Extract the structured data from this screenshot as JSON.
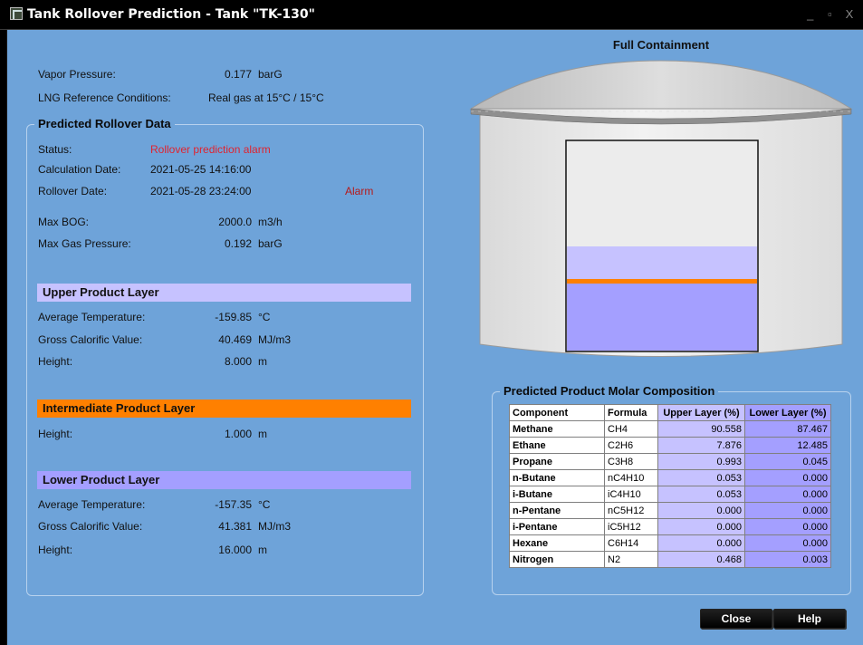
{
  "window": {
    "title": "Tank Rollover Prediction - Tank \"TK-130\"",
    "minimize": "_",
    "maximize": "▫",
    "close": "X"
  },
  "summary": {
    "vapor_pressure_label": "Vapor Pressure:",
    "vapor_pressure_value": "0.177",
    "vapor_pressure_unit": "barG",
    "lng_ref_label": "LNG Reference Conditions:",
    "lng_ref_value": "Real gas at 15°C / 15°C"
  },
  "rollover": {
    "group_title": "Predicted Rollover Data",
    "status_label": "Status:",
    "status_value": "Rollover prediction alarm",
    "calc_date_label": "Calculation Date:",
    "calc_date_value": "2021-05-25 14:16:00",
    "rollover_date_label": "Rollover Date:",
    "rollover_date_value": "2021-05-28 23:24:00",
    "alarm_text": "Alarm",
    "max_bog_label": "Max BOG:",
    "max_bog_value": "2000.0",
    "max_bog_unit": "m3/h",
    "max_gas_pressure_label": "Max Gas Pressure:",
    "max_gas_pressure_value": "0.192",
    "max_gas_pressure_unit": "barG"
  },
  "upper": {
    "title": "Upper Product Layer",
    "avg_temp_label": "Average Temperature:",
    "avg_temp_value": "-159.85",
    "avg_temp_unit": "°C",
    "gcv_label": "Gross Calorific Value:",
    "gcv_value": "40.469",
    "gcv_unit": "MJ/m3",
    "height_label": "Height:",
    "height_value": "8.000",
    "height_unit": "m"
  },
  "intermediate": {
    "title": "Intermediate Product Layer",
    "height_label": "Height:",
    "height_value": "1.000",
    "height_unit": "m"
  },
  "lower": {
    "title": "Lower Product Layer",
    "avg_temp_label": "Average Temperature:",
    "avg_temp_value": "-157.35",
    "avg_temp_unit": "°C",
    "gcv_label": "Gross Calorific Value:",
    "gcv_value": "41.381",
    "gcv_unit": "MJ/m3",
    "height_label": "Height:",
    "height_value": "16.000",
    "height_unit": "m"
  },
  "tank": {
    "title": "Full Containment"
  },
  "composition": {
    "group_title": "Predicted Product Molar Composition",
    "headers": [
      "Component",
      "Formula",
      "Upper Layer (%)",
      "Lower Layer (%)"
    ],
    "rows": [
      [
        "Methane",
        "CH4",
        "90.558",
        "87.467"
      ],
      [
        "Ethane",
        "C2H6",
        "7.876",
        "12.485"
      ],
      [
        "Propane",
        "C3H8",
        "0.993",
        "0.045"
      ],
      [
        "n-Butane",
        "nC4H10",
        "0.053",
        "0.000"
      ],
      [
        "i-Butane",
        "iC4H10",
        "0.053",
        "0.000"
      ],
      [
        "n-Pentane",
        "nC5H12",
        "0.000",
        "0.000"
      ],
      [
        "i-Pentane",
        "iC5H12",
        "0.000",
        "0.000"
      ],
      [
        "Hexane",
        "C6H14",
        "0.000",
        "0.000"
      ],
      [
        "Nitrogen",
        "N2",
        "0.468",
        "0.003"
      ]
    ]
  },
  "buttons": {
    "close": "Close",
    "help": "Help"
  },
  "colors": {
    "background": "#6ea3d9",
    "upper_layer": "#c6c2ff",
    "lower_layer": "#a49fff",
    "intermediate_layer": "#ff8000",
    "alarm_text": "#e0232f"
  }
}
